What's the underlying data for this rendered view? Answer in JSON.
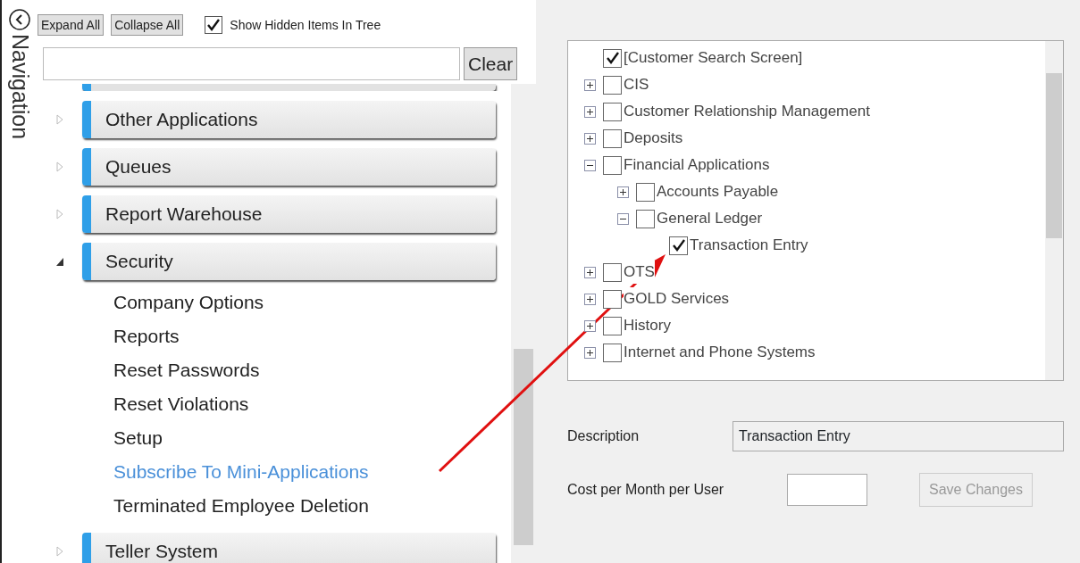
{
  "navigation": {
    "title": "Navigation",
    "expand_all": "Expand All",
    "collapse_all": "Collapse All",
    "show_hidden": {
      "label": "Show Hidden Items In Tree",
      "checked": true
    },
    "search": {
      "button": "Clear"
    },
    "groups": [
      {
        "label": "Other Applications",
        "expanded": false
      },
      {
        "label": "Queues",
        "expanded": false
      },
      {
        "label": "Report Warehouse",
        "expanded": false
      },
      {
        "label": "Security",
        "expanded": true,
        "items": [
          {
            "label": "Company Options",
            "selected": false
          },
          {
            "label": "Reports",
            "selected": false
          },
          {
            "label": "Reset Passwords",
            "selected": false
          },
          {
            "label": "Reset Violations",
            "selected": false
          },
          {
            "label": "Setup",
            "selected": false
          },
          {
            "label": "Subscribe To Mini-Applications",
            "selected": true
          },
          {
            "label": "Terminated Employee Deletion",
            "selected": false
          }
        ]
      },
      {
        "label": "Teller System",
        "expanded": false
      }
    ]
  },
  "tree": [
    {
      "label": "[Customer Search Screen]",
      "checked": true
    },
    {
      "label": "CIS",
      "checked": false,
      "expanded": false
    },
    {
      "label": "Customer Relationship Management",
      "checked": false,
      "expanded": false
    },
    {
      "label": "Deposits",
      "checked": false,
      "expanded": false
    },
    {
      "label": "Financial Applications",
      "checked": false,
      "expanded": true,
      "children": [
        {
          "label": "Accounts Payable",
          "checked": false,
          "expanded": false
        },
        {
          "label": "General Ledger",
          "checked": false,
          "expanded": true,
          "children": [
            {
              "label": "Transaction Entry",
              "checked": true
            }
          ]
        }
      ]
    },
    {
      "label": "OTS",
      "checked": false,
      "expanded": false
    },
    {
      "label": "GOLD Services",
      "checked": false,
      "expanded": false
    },
    {
      "label": "History",
      "checked": false,
      "expanded": false
    },
    {
      "label": "Internet and Phone Systems",
      "checked": false,
      "expanded": false
    }
  ],
  "details": {
    "description_label": "Description",
    "description_value": "Transaction Entry",
    "cost_label": "Cost per Month per User",
    "save_button": {
      "label": "Save Changes",
      "disabled": true
    }
  }
}
